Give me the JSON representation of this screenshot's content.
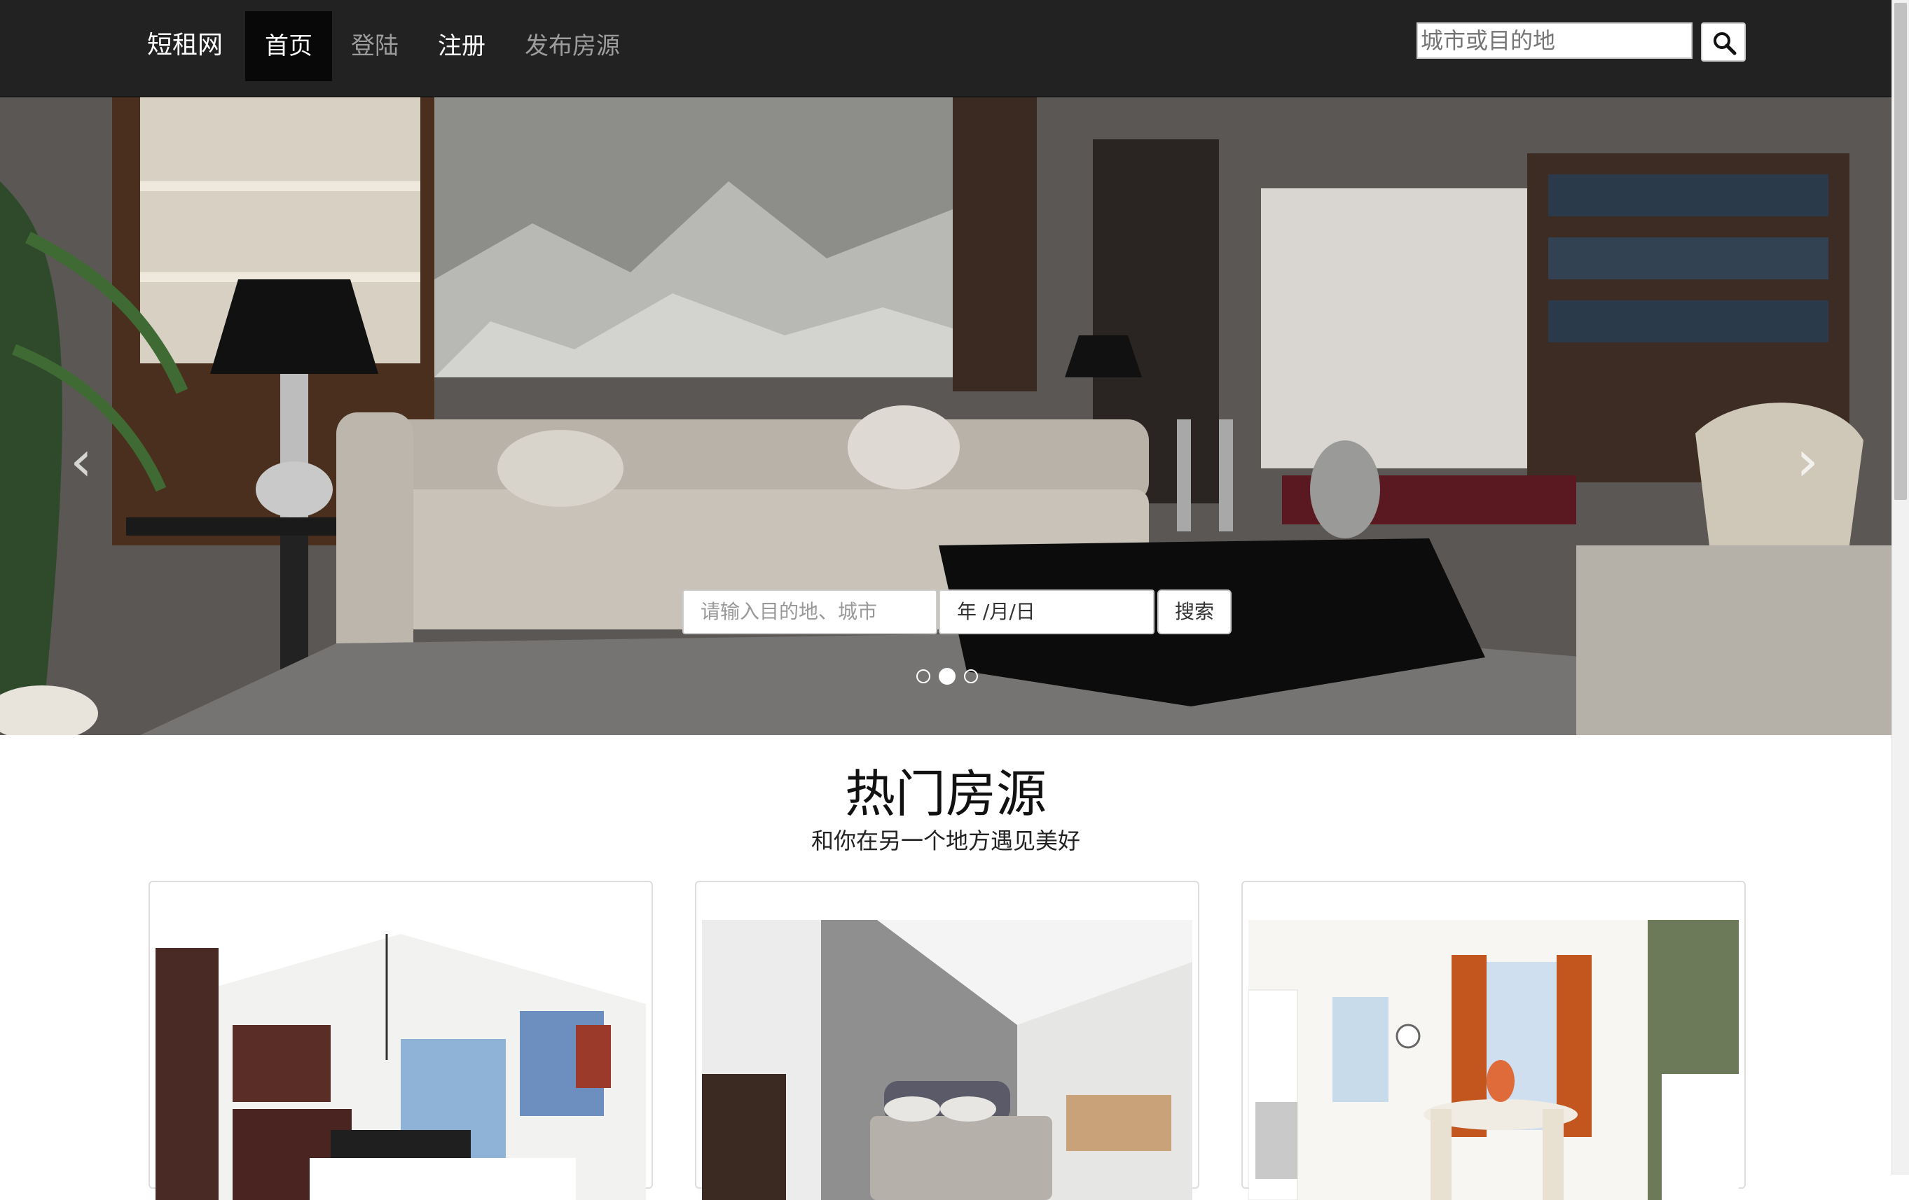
{
  "navbar": {
    "brand": "短租网",
    "items": [
      {
        "label": "首页",
        "active": true
      },
      {
        "label": "登陆",
        "active": false
      },
      {
        "label": "注册",
        "active": false
      },
      {
        "label": "发布房源",
        "active": false
      }
    ],
    "search_placeholder": "城市或目的地",
    "search_icon": "search-icon"
  },
  "hero": {
    "prev_arrow": "‹",
    "next_arrow": "›",
    "destination_placeholder": "请输入目的地、城市",
    "date_placeholder": "年 /月/日",
    "search_label": "搜索",
    "slides": 3,
    "active_slide": 2
  },
  "section": {
    "title": "热门房源",
    "subtitle": "和你在另一个地方遇见美好"
  },
  "listings": [
    {
      "image": "kitchen-photo"
    },
    {
      "image": "bedroom-photo"
    },
    {
      "image": "dining-room-photo"
    }
  ],
  "colors": {
    "navbar_bg": "#222222",
    "nav_active_bg": "#080808",
    "nav_text_muted": "#9d9d9d"
  }
}
